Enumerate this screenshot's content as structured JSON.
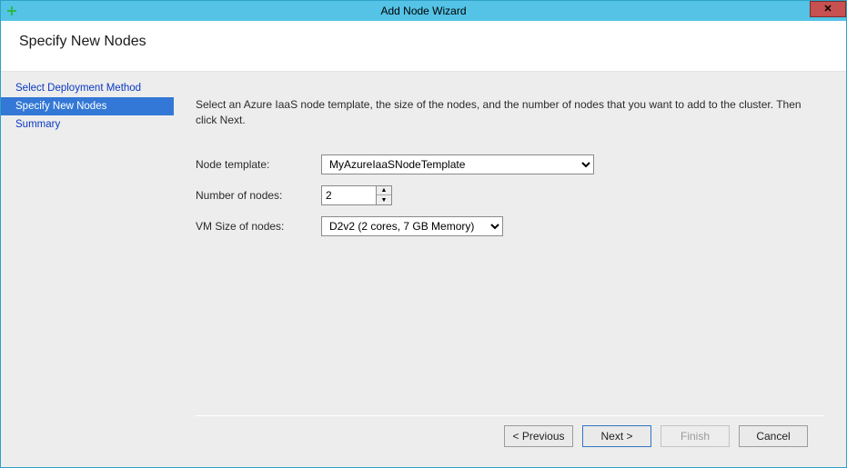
{
  "window": {
    "title": "Add Node Wizard"
  },
  "header": {
    "title": "Specify New Nodes"
  },
  "sidebar": {
    "items": [
      {
        "label": "Select Deployment Method",
        "active": false
      },
      {
        "label": "Specify New Nodes",
        "active": true
      },
      {
        "label": "Summary",
        "active": false
      }
    ]
  },
  "content": {
    "intro": "Select an Azure IaaS node template, the size of the nodes, and the number of nodes that you want to add to the cluster. Then click Next.",
    "fields": {
      "node_template": {
        "label": "Node template:",
        "value": "MyAzureIaaSNodeTemplate"
      },
      "number_of_nodes": {
        "label": "Number of nodes:",
        "value": "2"
      },
      "vm_size": {
        "label": "VM Size of nodes:",
        "value": "D2v2 (2 cores, 7 GB Memory)"
      }
    }
  },
  "footer": {
    "previous": "< Previous",
    "next": "Next >",
    "finish": "Finish",
    "cancel": "Cancel"
  }
}
